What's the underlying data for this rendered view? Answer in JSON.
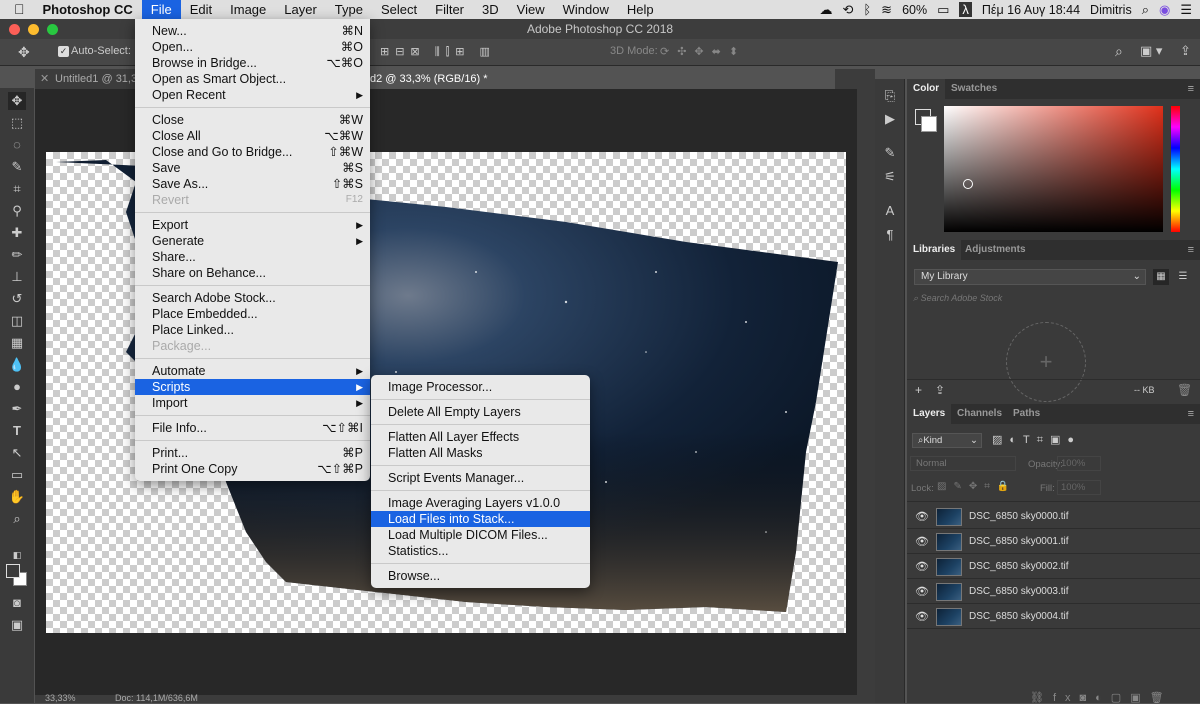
{
  "mac_menubar": {
    "apple_icon": "apple-logo",
    "app_name": "Photoshop CC",
    "menus": [
      "File",
      "Edit",
      "Image",
      "Layer",
      "Type",
      "Select",
      "Filter",
      "3D",
      "View",
      "Window",
      "Help"
    ],
    "active_menu": "File",
    "battery": "60%",
    "clock": "Πέμ 16 Αυγ  18:44",
    "user": "Dimitris"
  },
  "window": {
    "title": "Adobe Photoshop CC 2018"
  },
  "options_bar": {
    "auto_select_label": "Auto-Select:",
    "mode_3d_label": "3D Mode:"
  },
  "doc_tabs": [
    {
      "label": "Untitled1 @ 31,3"
    },
    {
      "label": "d2 @ 33,3% (RGB/16) *"
    }
  ],
  "status": {
    "zoom": "33,33%",
    "doc": "Doc: 114,1M/636,6M"
  },
  "file_menu": {
    "groups": [
      [
        {
          "label": "New...",
          "sc": "⌘N"
        },
        {
          "label": "Open...",
          "sc": "⌘O"
        },
        {
          "label": "Browse in Bridge...",
          "sc": "⌥⌘O"
        },
        {
          "label": "Open as Smart Object...",
          "sc": ""
        },
        {
          "label": "Open Recent",
          "sc": "▶"
        }
      ],
      [
        {
          "label": "Close",
          "sc": "⌘W"
        },
        {
          "label": "Close All",
          "sc": "⌥⌘W"
        },
        {
          "label": "Close and Go to Bridge...",
          "sc": "⇧⌘W"
        },
        {
          "label": "Save",
          "sc": "⌘S"
        },
        {
          "label": "Save As...",
          "sc": "⇧⌘S"
        },
        {
          "label": "Revert",
          "sc": "F12",
          "disabled": true
        }
      ],
      [
        {
          "label": "Export",
          "sc": "▶"
        },
        {
          "label": "Generate",
          "sc": "▶"
        },
        {
          "label": "Share...",
          "sc": ""
        },
        {
          "label": "Share on Behance...",
          "sc": ""
        }
      ],
      [
        {
          "label": "Search Adobe Stock...",
          "sc": ""
        },
        {
          "label": "Place Embedded...",
          "sc": ""
        },
        {
          "label": "Place Linked...",
          "sc": ""
        },
        {
          "label": "Package...",
          "sc": "",
          "disabled": true
        }
      ],
      [
        {
          "label": "Automate",
          "sc": "▶"
        },
        {
          "label": "Scripts",
          "sc": "▶",
          "highlighted": true
        },
        {
          "label": "Import",
          "sc": "▶"
        }
      ],
      [
        {
          "label": "File Info...",
          "sc": "⌥⇧⌘I"
        }
      ],
      [
        {
          "label": "Print...",
          "sc": "⌘P"
        },
        {
          "label": "Print One Copy",
          "sc": "⌥⇧⌘P"
        }
      ]
    ]
  },
  "scripts_submenu": {
    "groups": [
      [
        {
          "label": "Image Processor..."
        }
      ],
      [
        {
          "label": "Delete All Empty Layers"
        }
      ],
      [
        {
          "label": "Flatten All Layer Effects"
        },
        {
          "label": "Flatten All Masks"
        }
      ],
      [
        {
          "label": "Script Events Manager..."
        }
      ],
      [
        {
          "label": "Image Averaging Layers v1.0.0"
        },
        {
          "label": "Load Files into Stack...",
          "highlighted": true
        },
        {
          "label": "Load Multiple DICOM Files..."
        },
        {
          "label": "Statistics..."
        }
      ],
      [
        {
          "label": "Browse..."
        }
      ]
    ]
  },
  "color_panel": {
    "tabs": [
      "Color",
      "Swatches"
    ],
    "hue_color": "#e0301a"
  },
  "libraries_panel": {
    "tabs": [
      "Libraries",
      "Adjustments"
    ],
    "library": "My Library",
    "search_placeholder": "Search Adobe Stock",
    "size": "-- KB"
  },
  "layers_panel": {
    "tabs": [
      "Layers",
      "Channels",
      "Paths"
    ],
    "kind_label": "Kind",
    "blend_mode": "Normal",
    "opacity_label": "Opacity:",
    "opacity": "100%",
    "lock_label": "Lock:",
    "fill_label": "Fill:",
    "fill": "100%",
    "layers": [
      "DSC_6850 sky0000.tif",
      "DSC_6850 sky0001.tif",
      "DSC_6850 sky0002.tif",
      "DSC_6850 sky0003.tif",
      "DSC_6850 sky0004.tif"
    ]
  }
}
